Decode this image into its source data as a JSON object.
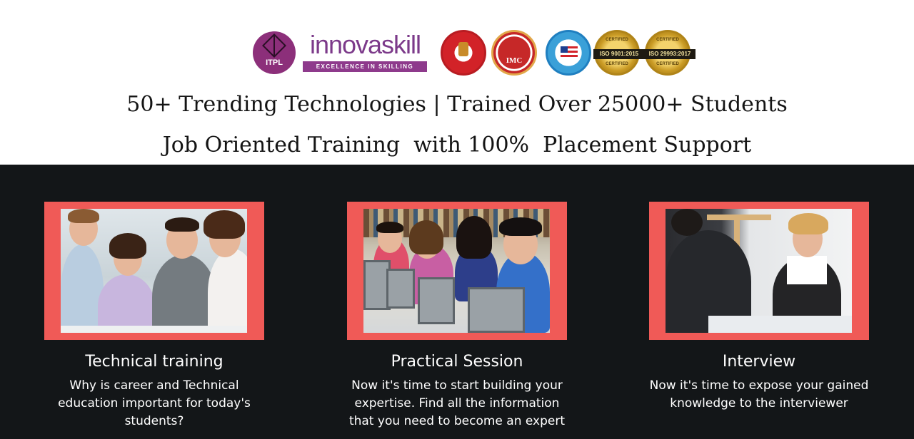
{
  "header": {
    "itpl_label": "ITPL",
    "brand_name": "innovaskill",
    "brand_tagline": "EXCELLENCE IN SKILLING",
    "badges": {
      "imc_label": "IMC",
      "iso1": "ISO 9001:2015",
      "iso2": "ISO 29993:2017",
      "certified": "CERTIFIED"
    },
    "headline_1": "50+ Trending Technologies | Trained Over 25000+ Students",
    "headline_2": "Job Oriented Training  with 100%  Placement Support"
  },
  "features": [
    {
      "title": "Technical training",
      "description": "Why is career and Technical education important for today's students?"
    },
    {
      "title": "Practical Session",
      "description": "Now it's time to start building your expertise. Find all the information that you need to become an expert"
    },
    {
      "title": "Interview",
      "description": "Now it's time to expose your gained knowledge to the interviewer"
    }
  ],
  "colors": {
    "background_dark": "#131618",
    "card_frame": "#f05a57",
    "brand_purple": "#7c3a8a"
  }
}
